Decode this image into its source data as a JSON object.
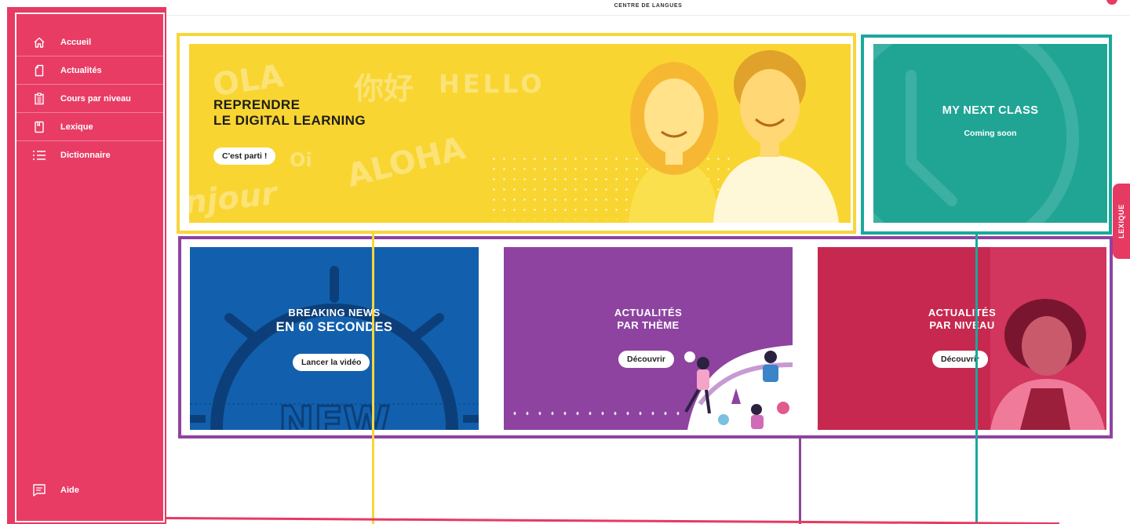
{
  "header": {
    "brand": "CENTRE DE LANGUES"
  },
  "sidebar": {
    "items": [
      {
        "label": "Accueil",
        "icon": "home-icon"
      },
      {
        "label": "Actualités",
        "icon": "document-icon"
      },
      {
        "label": "Cours par niveau",
        "icon": "clipboard-icon"
      },
      {
        "label": "Lexique",
        "icon": "notebook-icon"
      },
      {
        "label": "Dictionnaire",
        "icon": "list-icon"
      }
    ],
    "help": {
      "label": "Aide",
      "icon": "chat-icon"
    }
  },
  "hero": {
    "title_line1": "REPRENDRE",
    "title_line2": "LE DIGITAL LEARNING",
    "button": "C'est parti !"
  },
  "next_class": {
    "title": "MY NEXT CLASS",
    "subtitle": "Coming soon"
  },
  "side_tab": {
    "label": "LEXIQUE"
  },
  "cards": [
    {
      "line1": "BREAKING NEWS",
      "line2": "EN 60 SECONDES",
      "button": "Lancer la vidéo"
    },
    {
      "line1": "ACTUALITÉS",
      "line2": "PAR THÈME",
      "button": "Découvrir"
    },
    {
      "line1": "ACTUALITÉS",
      "line2": "PAR NIVEAU",
      "button": "Découvrir"
    }
  ],
  "colors": {
    "brand": "#e63a63",
    "hero_yellow": "#f9d531",
    "teal": "#20a595",
    "blue": "#1260ad",
    "purple": "#8e43a0",
    "red": "#c7284f"
  }
}
